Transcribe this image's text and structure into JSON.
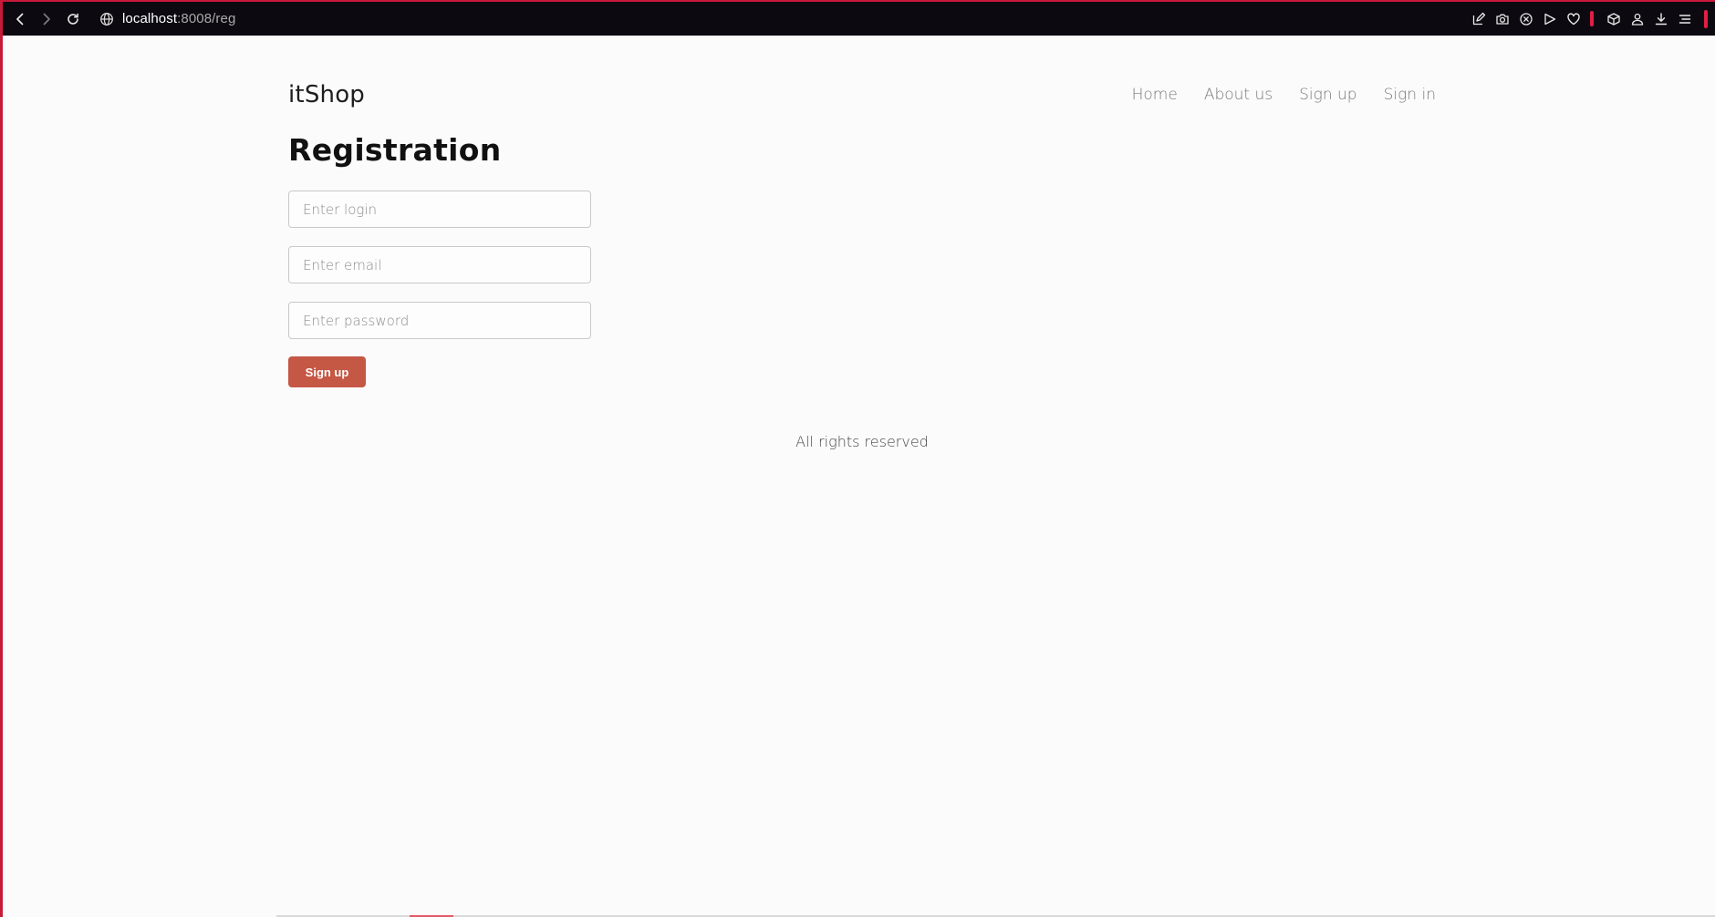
{
  "browser": {
    "url_host": "localhost",
    "url_rest": ":8008/reg",
    "icons": [
      "back-icon",
      "forward-icon",
      "reload-icon",
      "globe-icon",
      "edit-icon",
      "camera-icon",
      "shield-x-icon",
      "send-icon",
      "heart-icon",
      "box-icon",
      "profile-icon",
      "download-icon",
      "menu-icon"
    ],
    "accent_color": "#e01e46"
  },
  "header": {
    "brand": "itShop",
    "nav": [
      "Home",
      "About us",
      "Sign up",
      "Sign in"
    ]
  },
  "main": {
    "title": "Registration",
    "login_placeholder": "Enter login",
    "email_placeholder": "Enter email",
    "password_placeholder": "Enter password",
    "submit_label": "Sign up",
    "button_color": "#c55745"
  },
  "footer": {
    "text": "All rights reserved"
  }
}
